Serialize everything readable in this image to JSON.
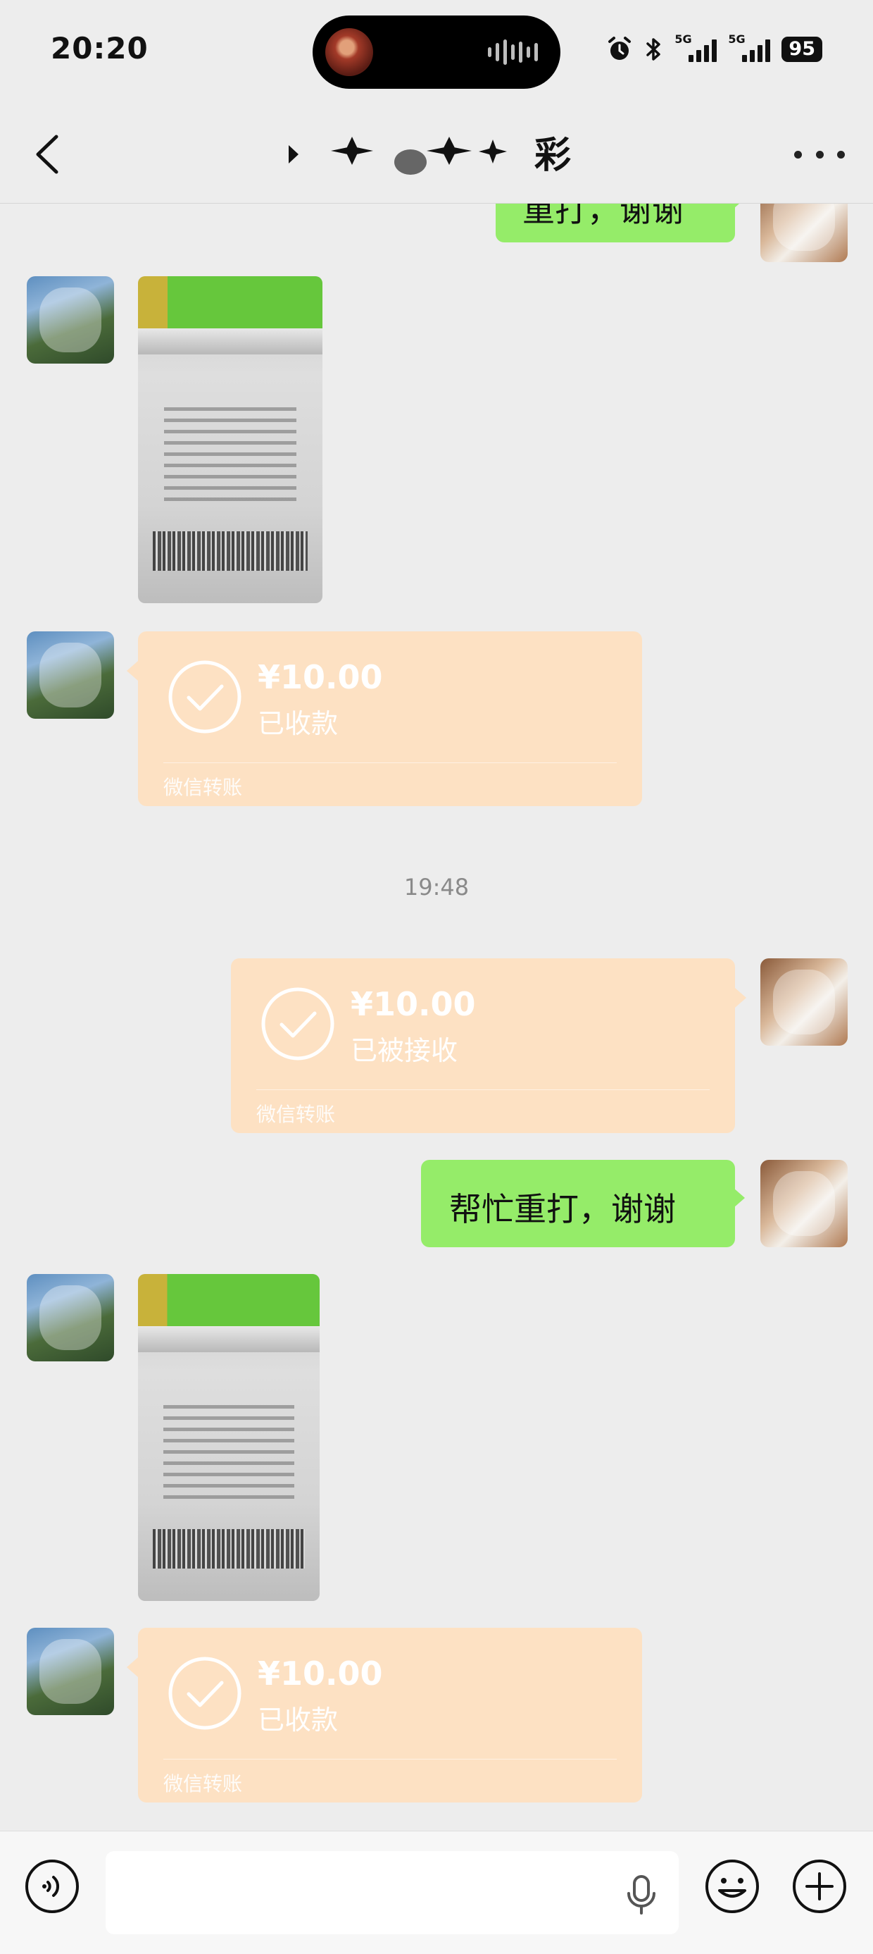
{
  "status_bar": {
    "time": "20:20",
    "signal_1_label": "5G",
    "signal_2_label": "5G",
    "battery": "95"
  },
  "header": {
    "title": "彩",
    "back_icon": "chevron-left-icon",
    "more_icon": "more-horizontal-icon"
  },
  "messages": [
    {
      "type": "text",
      "side": "right",
      "text": "重打，谢谢"
    },
    {
      "type": "image",
      "side": "left",
      "content": "lottery-ticket-photo"
    },
    {
      "type": "transfer",
      "side": "left",
      "amount": "¥10.00",
      "status": "已收款",
      "label": "微信转账"
    },
    {
      "type": "timestamp",
      "text": "19:48"
    },
    {
      "type": "transfer",
      "side": "right",
      "amount": "¥10.00",
      "status": "已被接收",
      "label": "微信转账"
    },
    {
      "type": "text",
      "side": "right",
      "text": "帮忙重打，谢谢"
    },
    {
      "type": "image",
      "side": "left",
      "content": "lottery-ticket-photo"
    },
    {
      "type": "transfer",
      "side": "left",
      "amount": "¥10.00",
      "status": "已收款",
      "label": "微信转账"
    }
  ],
  "input_bar": {
    "voice_icon": "voice-mode-icon",
    "input_value": "",
    "mic_icon": "microphone-icon",
    "emoji_icon": "emoji-icon",
    "plus_icon": "plus-icon"
  },
  "colors": {
    "background": "#ededed",
    "outgoing_bubble": "#95ec69",
    "transfer_card": "#fde1c3"
  }
}
